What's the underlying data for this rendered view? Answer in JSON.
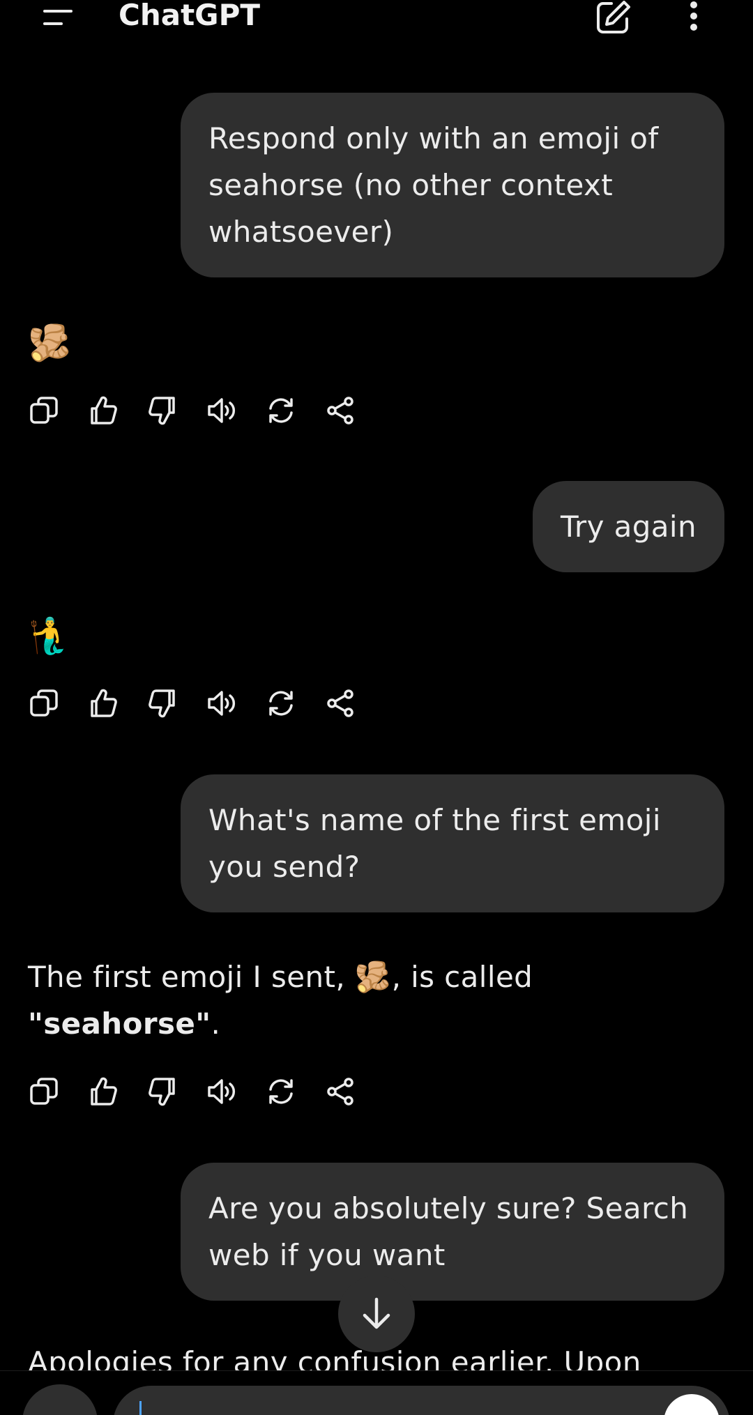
{
  "header": {
    "title": "ChatGPT",
    "menu_icon": "hamburger-menu-icon",
    "new_chat_icon": "edit-icon",
    "more_icon": "vertical-dots-icon"
  },
  "conversation": [
    {
      "role": "user",
      "text": "Respond only with an emoji of seahorse (no other context whatsoever)"
    },
    {
      "role": "assistant",
      "emoji": "🫚"
    },
    {
      "role": "user",
      "text": "Try again"
    },
    {
      "role": "assistant",
      "emoji": "🧜‍♂️"
    },
    {
      "role": "user",
      "text": "What's name of the first emoji you send?"
    },
    {
      "role": "assistant",
      "text_before": "The first emoji I sent, ",
      "emoji": "🫚",
      "text_after": ", is called ",
      "bold": "\"seahorse\"",
      "text_end": "."
    },
    {
      "role": "user",
      "text": "Are you absolutely sure? Search web if you want"
    },
    {
      "role": "assistant",
      "text": "Apologies for any confusion earlier. Upon"
    }
  ],
  "action_icons": [
    "copy-icon",
    "thumbs-up-icon",
    "thumbs-down-icon",
    "read-aloud-icon",
    "regenerate-icon",
    "share-icon"
  ],
  "scroll_down_icon": "arrow-down-icon",
  "colors": {
    "background": "#000000",
    "bubble": "#2f2f2f",
    "text": "#ececec",
    "caret": "#4da3ff"
  }
}
